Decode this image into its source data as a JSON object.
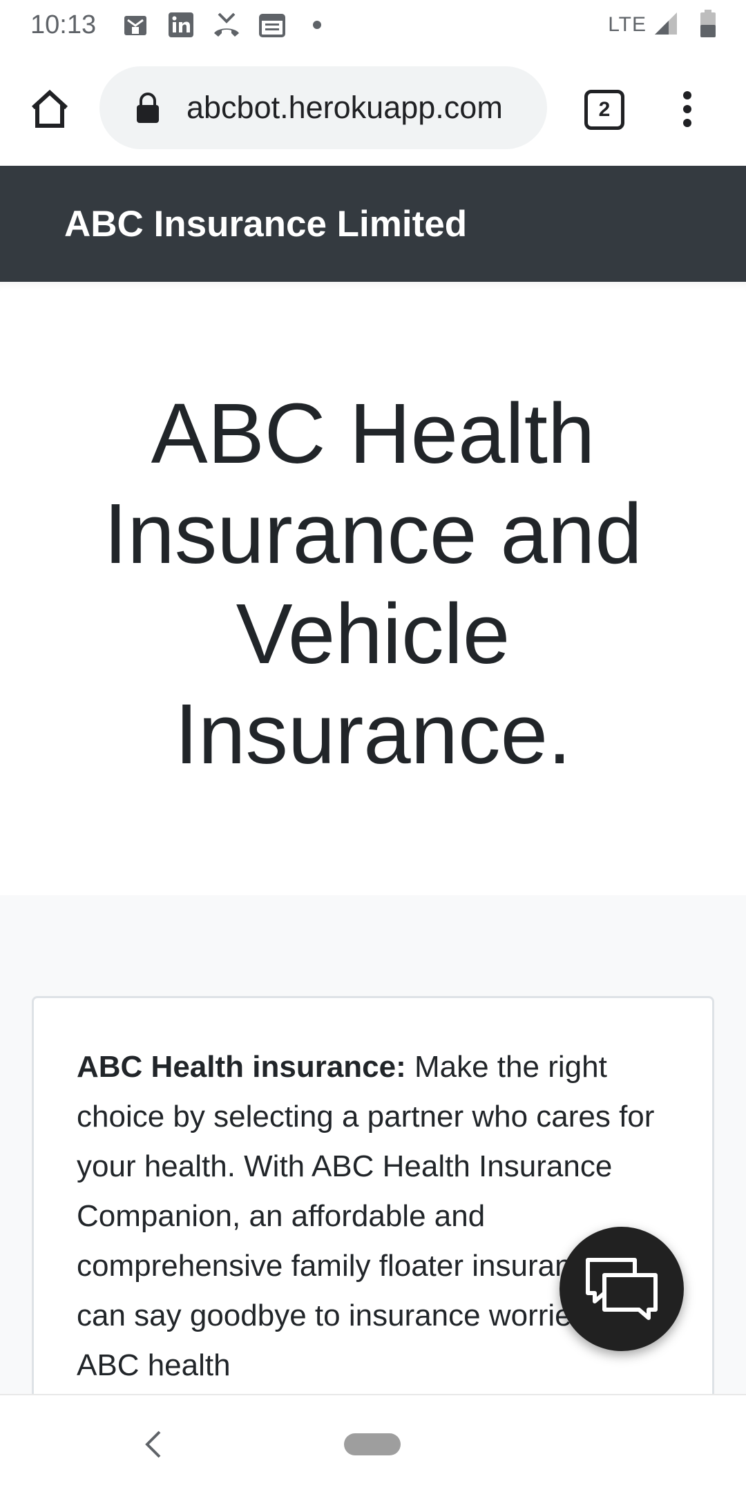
{
  "status_bar": {
    "time": "10:13",
    "icons": [
      "gmail-icon",
      "linkedin-icon",
      "missed-call-icon",
      "calendar-icon"
    ],
    "network": "LTE"
  },
  "browser": {
    "url": "abcbot.herokuapp.com",
    "tab_count": "2"
  },
  "navbar": {
    "brand": "ABC Insurance Limited",
    "color": "#343a40"
  },
  "hero": {
    "title": "ABC Health Insurance and Vehicle Insurance."
  },
  "card": {
    "bold_lead": "ABC Health insurance:",
    "text": " Make the right choice by selecting a partner who cares for your health. With ABC Health Insurance Companion, an affordable and comprehensive family floater insurance, you can say goodbye to insurance worries. With ABC health"
  },
  "chat": {
    "icon": "chat-icon"
  }
}
